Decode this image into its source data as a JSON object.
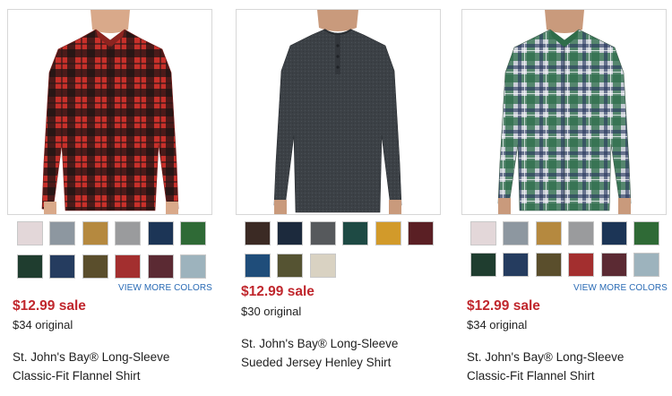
{
  "colors": {
    "sale": "#c0272d",
    "link": "#2a6bb5",
    "text": "#1f1f1f"
  },
  "products": [
    {
      "image": "red-black-buffalo-plaid-flannel-shirt-photo",
      "swatches": [
        "#e3d7d9",
        "#8d97a0",
        "#b5893f",
        "#9a9b9d",
        "#1c3556",
        "#2f6a36",
        "#1f3d2f",
        "#253c5f",
        "#5a4e2c",
        "#a32f2f",
        "#5b2a33",
        "#9db3bd"
      ],
      "more_colors": "VIEW MORE COLORS",
      "sale": "$12.99 sale",
      "original": "$34 original",
      "title_line1": "St. John's Bay® Long-Sleeve",
      "title_line2": "Classic-Fit Flannel Shirt"
    },
    {
      "image": "charcoal-henley-shirt-photo",
      "swatches": [
        "#3b2a24",
        "#1c2a3d",
        "#56595c",
        "#1e4a44",
        "#d29a2a",
        "#5a1f24",
        "#1f4d7a",
        "#555332",
        "#d9d2c2"
      ],
      "sale": "$12.99 sale",
      "original": "$30 original",
      "title_line1": "St. John's Bay® Long-Sleeve",
      "title_line2": "Sueded Jersey Henley Shirt"
    },
    {
      "image": "green-gray-plaid-flannel-shirt-photo",
      "swatches": [
        "#e3d7d9",
        "#8d97a0",
        "#b5893f",
        "#9a9b9d",
        "#1c3556",
        "#2f6a36",
        "#1f3d2f",
        "#253c5f",
        "#5a4e2c",
        "#a32f2f",
        "#5b2a33",
        "#9db3bd"
      ],
      "more_colors": "VIEW MORE COLORS",
      "sale": "$12.99 sale",
      "original": "$34 original",
      "title_line1": "St. John's Bay® Long-Sleeve",
      "title_line2": "Classic-Fit Flannel Shirt"
    }
  ]
}
